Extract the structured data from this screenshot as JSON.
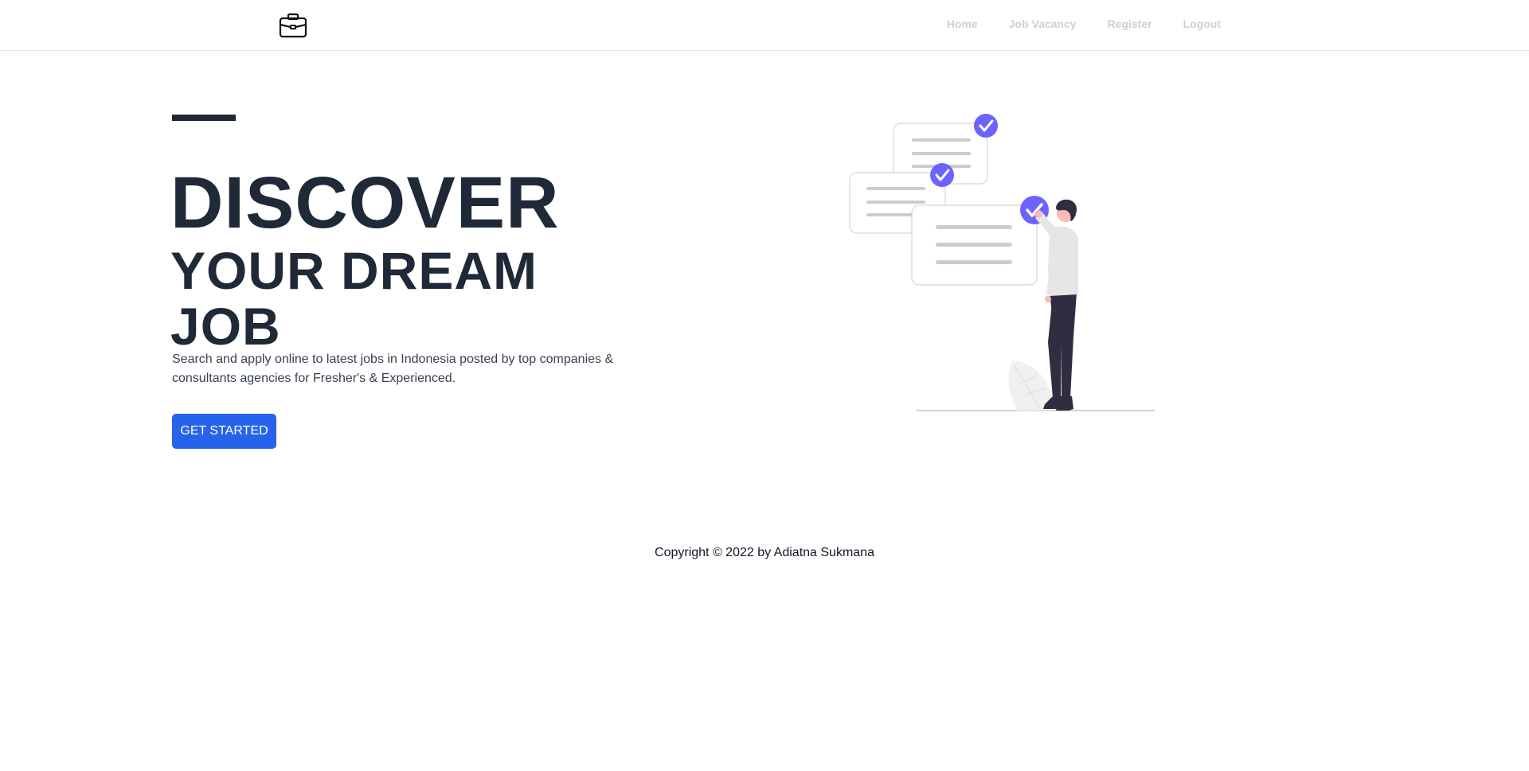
{
  "app": {
    "logo_icon": "briefcase-icon"
  },
  "nav": {
    "items": [
      {
        "label": "Home"
      },
      {
        "label": "Job Vacancy"
      },
      {
        "label": "Register"
      },
      {
        "label": "Logout"
      }
    ]
  },
  "hero": {
    "title_line1": "DISCOVER",
    "title_line2": "YOUR DREAM",
    "title_line3": "JOB",
    "subtitle": "Search and apply online to latest jobs in Indonesia posted by top companies & consultants agencies for Fresher's & Experienced.",
    "cta_label": "GET STARTED",
    "illustration": "person-checking-documents-illustration"
  },
  "footer": {
    "copyright": "Copyright © 2022 by Adiatna Sukmana"
  },
  "colors": {
    "primary": "#2563eb",
    "heading": "#1f2937",
    "nav_text": "#cbd0d8",
    "check_accent": "#6c63ff"
  }
}
